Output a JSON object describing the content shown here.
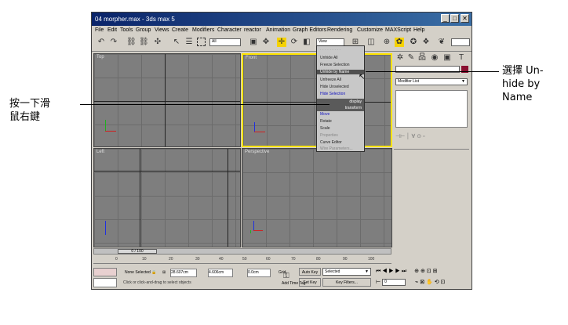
{
  "window": {
    "title": "04 morpher.max - 3ds max 5",
    "controls": [
      "_",
      "□",
      "✕"
    ]
  },
  "menubar": [
    "File",
    "Edit",
    "Tools",
    "Group",
    "Views",
    "Create",
    "Modifiers",
    "Character",
    "reactor",
    "Animation",
    "Graph Editors",
    "Rendering",
    "Customize",
    "MAXScript",
    "Help"
  ],
  "toolbar": {
    "selection_filter": "All",
    "reference_coord": "View"
  },
  "viewports": {
    "top": "Top",
    "front": "Front",
    "left": "Left",
    "perspective": "Perspective"
  },
  "quad_menu": {
    "items": [
      "Unhide All",
      "Freeze Selection",
      "Unhide by Name",
      "Unfreeze All",
      "Hide Unselected",
      "Hide Selection"
    ],
    "display_header": "display",
    "transform_header": "transform",
    "transform_items": [
      "Move",
      "Rotate",
      "Scale",
      "Properties",
      "Curve Editor",
      "Wire Parameters..."
    ]
  },
  "command_panel": {
    "modifier_list": "Modifier List"
  },
  "timeline": {
    "slider_text": "0 / 100",
    "ticks": [
      "0",
      "10",
      "20",
      "30",
      "40",
      "50",
      "60",
      "70",
      "80",
      "90",
      "100"
    ]
  },
  "status": {
    "selection": "None Selected",
    "x": "28.607cm",
    "y": "4.606cm",
    "z": "0.0cm",
    "grid_label": "Grid",
    "auto_key": "Auto Key",
    "set_key": "Set Key",
    "selected_dropdown": "Selected",
    "key_filters": "Key Filters...",
    "frame": "0",
    "prompt": "Click or click-and-drag to select objects",
    "add_time_tag": "Add Time Tag"
  },
  "annotations": {
    "right_text": "選擇 Un-\nhide by\nName",
    "left_text": "按一下滑\n鼠右鍵"
  }
}
